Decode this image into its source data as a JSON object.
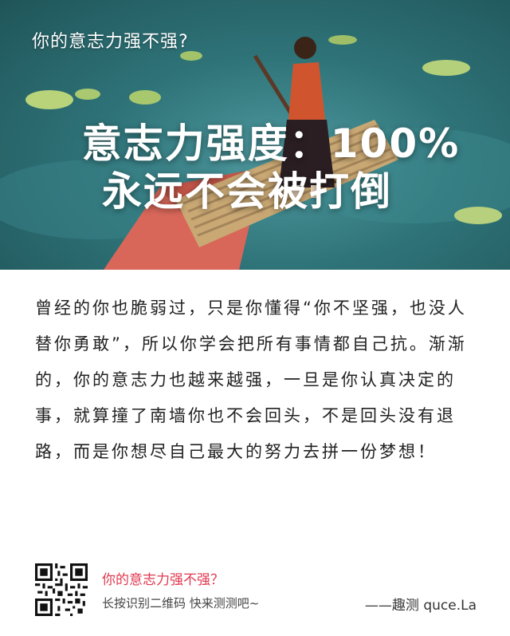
{
  "hero": {
    "title": "你的意志力强不强?",
    "result_line1": "意志力强度：100%",
    "result_line2": "永远不会被打倒"
  },
  "description": "曾经的你也脆弱过，只是你懂得“你不坚强，也没人替你勇敢”，所以你学会把所有事情都自己抗。渐渐的，你的意志力也越来越强，一旦是你认真决定的事，就算撞了南墙你也不会回头，不是回头没有退路，而是你想尽自己最大的努力去拼一份梦想！",
  "footer": {
    "question": "你的意志力强不强？",
    "hint": "长按识别二维码  快来测测吧~",
    "brand": "——趣测 quce.La"
  }
}
